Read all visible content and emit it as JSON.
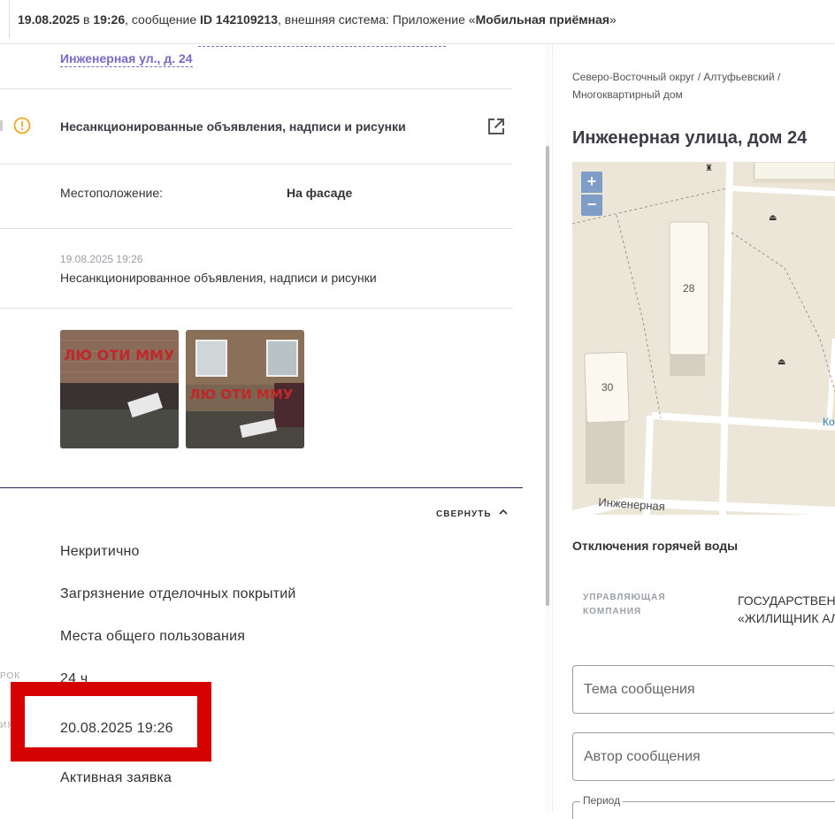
{
  "header": {
    "date": "19.08.2025",
    "in_word": "в",
    "time": "19:26",
    "message_word": ", сообщение",
    "message_id": "ID 142109213",
    "system_text": ", внешняя система: Приложение «",
    "app_name": "Мобильная приёмная",
    "close_quote": "»"
  },
  "left": {
    "address_link": "Инженерная ул., д. 24",
    "category_title": "Несанкционированные объявления, надписи и рисунки",
    "location_label": "Местоположение:",
    "location_value": "На фасаде",
    "comment_time": "19.08.2025 19:26",
    "comment_text": "Несанкционированное объявления, надписи и рисунки",
    "collapse_label": "СВЕРНУТЬ",
    "details": [
      "Некритично",
      "Загрязнение отделочных покрытий",
      "Места общего пользования",
      "24 ч",
      "20.08.2025 19:26",
      "Активная заявка"
    ],
    "cut_label_1": "РОК",
    "cut_label_2": "ИЯ  А",
    "photo_graffiti_1": "ЛЮ ОТИ ММУ",
    "photo_graffiti_2": "ЛЮ ОТИ ММУ"
  },
  "right": {
    "breadcrumb_line1": "Северо-Восточный округ / Алтуфьевский /",
    "breadcrumb_line2": "Многоквартирный дом",
    "house_title": "Инженерная улица, дом 24",
    "map": {
      "zoom_in": "+",
      "zoom_out": "−",
      "building_28": "28",
      "building_30": "30",
      "street_label": "Инженерная",
      "edge_label": "Ко"
    },
    "hot_water_title": "Отключения горячей воды",
    "mgmt_label_line1": "УПРАВЛЯЮЩАЯ",
    "mgmt_label_line2": "КОМПАНИЯ",
    "mgmt_value_line1": "ГОСУДАРСТВЕНН",
    "mgmt_value_line2": "«ЖИЛИЩНИК АЛ",
    "subject_placeholder": "Тема сообщения",
    "author_placeholder": "Автор сообщения",
    "period_label": "Период"
  },
  "colors": {
    "accent_link": "#7b68c8",
    "warning": "#f5a623",
    "highlight_box": "#d50000",
    "map_bg": "#ece6d8",
    "zoom_btn": "#7f9ec7"
  }
}
